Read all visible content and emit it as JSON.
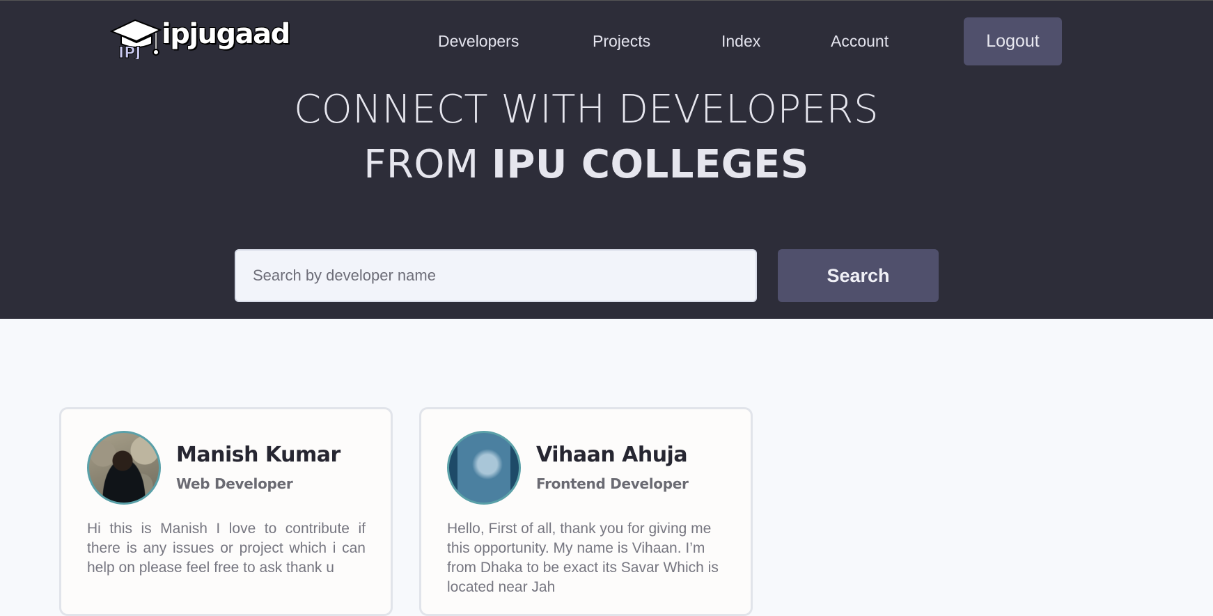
{
  "brand": {
    "name": "ipjugaad",
    "mark": "IPJ"
  },
  "nav": {
    "developers": "Developers",
    "projects": "Projects",
    "index": "Index",
    "account": "Account",
    "logout": "Logout"
  },
  "hero": {
    "line1": "CONNECT WITH DEVELOPERS",
    "line2_prefix": "FROM ",
    "line2_bold": "IPU COLLEGES"
  },
  "search": {
    "placeholder": "Search by developer name",
    "value": "",
    "button_label": "Search"
  },
  "developers": [
    {
      "name": "Manish Kumar",
      "role": "Web Developer",
      "bio": "Hi this is Manish I love to contribute if there is any issues or project which i can help on please feel free to ask thank u"
    },
    {
      "name": "Vihaan Ahuja",
      "role": "Frontend Developer",
      "bio": "Hello, First of all, thank you for giving me this opportunity. My name is Vihaan. I’m from Dhaka to be exact its Savar Which is located near Jah"
    }
  ],
  "colors": {
    "header_bg": "#2d2d39",
    "button_bg": "#50506c",
    "page_bg": "#f7f9fc",
    "avatar_border": "#5aa0a8"
  }
}
